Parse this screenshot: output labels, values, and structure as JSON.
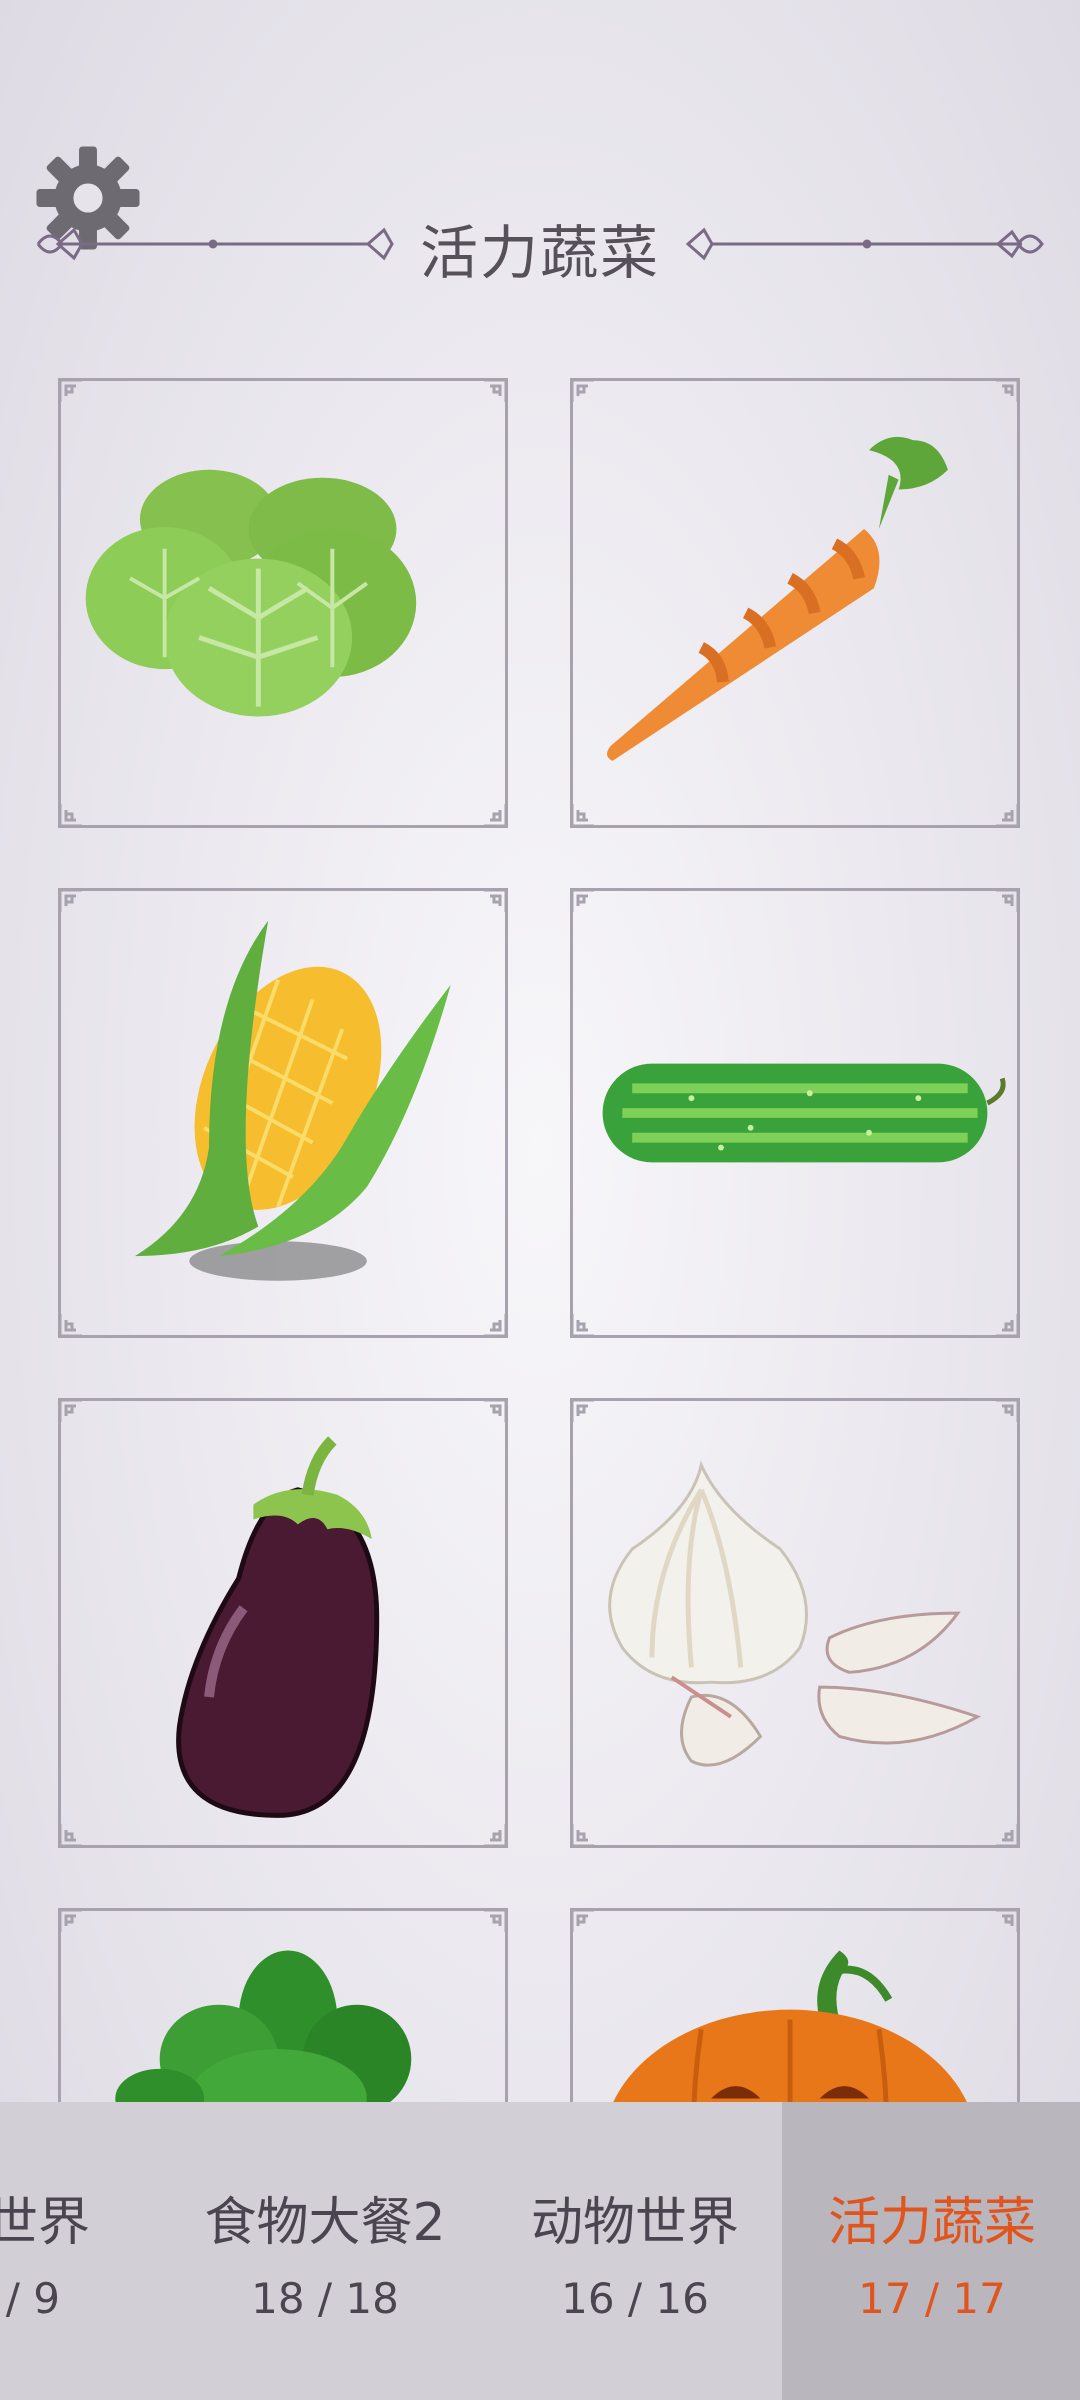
{
  "header": {
    "title": "活力蔬菜",
    "settings_icon": "gear-icon"
  },
  "grid": {
    "items": [
      {
        "name": "cabbage"
      },
      {
        "name": "carrot"
      },
      {
        "name": "corn"
      },
      {
        "name": "cucumber"
      },
      {
        "name": "eggplant"
      },
      {
        "name": "garlic"
      },
      {
        "name": "spinach"
      },
      {
        "name": "pumpkin"
      }
    ]
  },
  "tabs": [
    {
      "label": "卡通世界",
      "visible_label": "世界",
      "count": "/ 9"
    },
    {
      "label": "食物大餐2",
      "count": "18 / 18"
    },
    {
      "label": "动物世界",
      "count": "16 / 16"
    },
    {
      "label": "活力蔬菜",
      "count": "17 / 17",
      "active": true
    }
  ],
  "colors": {
    "accent": "#e0541d",
    "tab_bar": "#d2cfd6",
    "tab_active": "#b9b6be",
    "text": "#55505a"
  }
}
